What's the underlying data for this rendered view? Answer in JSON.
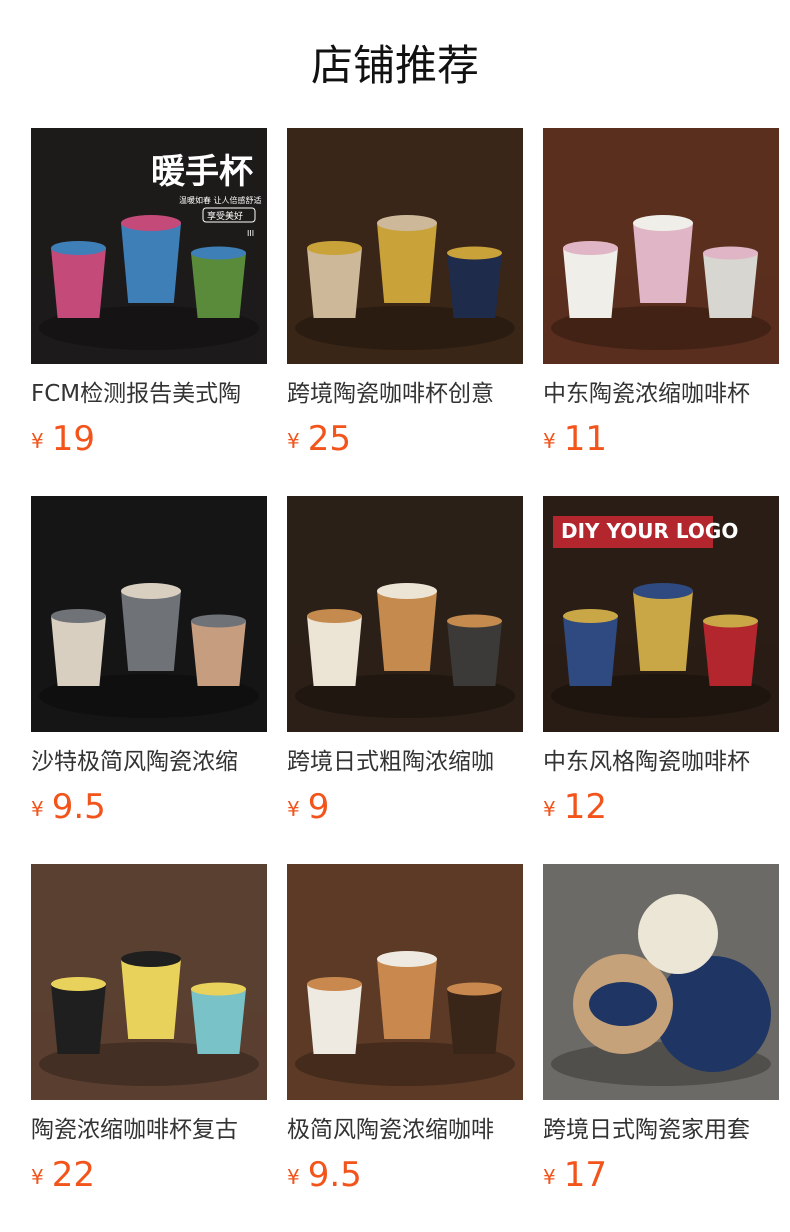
{
  "section": {
    "title": "店铺推荐"
  },
  "currency": "¥",
  "products": [
    {
      "name": "FCM检测报告美式陶",
      "price": "19",
      "image": "handwarmer-mug-banner",
      "overlay_title": "暖手杯",
      "overlay_sub": "温暖如春 让人倍感舒适",
      "overlay_tag": "享受美好",
      "overlay_page": "III",
      "colors": [
        "#1c1b1a",
        "#c44a7a",
        "#3f7fb8",
        "#5a8b3b"
      ]
    },
    {
      "name": "跨境陶瓷咖啡杯创意",
      "price": "25",
      "image": "gold-plate-coffee-cups",
      "colors": [
        "#3a2618",
        "#cdb99a",
        "#c9a23a",
        "#1f2b4a"
      ]
    },
    {
      "name": "中东陶瓷浓缩咖啡杯",
      "price": "11",
      "image": "pink-white-textured-cups",
      "colors": [
        "#5a2f1e",
        "#efeee9",
        "#e0b5c6",
        "#d8d6d0"
      ]
    },
    {
      "name": "沙特极简风陶瓷浓缩",
      "price": "9.5",
      "image": "hand-holding-engraved-cup",
      "colors": [
        "#151515",
        "#d9cfc0",
        "#6f7378",
        "#c79d80"
      ]
    },
    {
      "name": "跨境日式粗陶浓缩咖",
      "price": "9",
      "image": "latte-art-cups-slate",
      "colors": [
        "#2b2018",
        "#ece4d4",
        "#c48a4e",
        "#3c3a38"
      ]
    },
    {
      "name": "中东风格陶瓷咖啡杯",
      "price": "12",
      "image": "diy-logo-cups",
      "overlay_title": "DIY YOUR LOGO",
      "colors": [
        "#2a1d16",
        "#2f4a80",
        "#c9a646",
        "#b3262e"
      ]
    },
    {
      "name": "陶瓷浓缩咖啡杯复古",
      "price": "22",
      "image": "colorful-cups-set",
      "colors": [
        "#5a4030",
        "#1f1f1f",
        "#e9d25b",
        "#79c2c7"
      ]
    },
    {
      "name": "极简风陶瓷浓缩咖啡",
      "price": "9.5",
      "image": "white-cups-latte",
      "colors": [
        "#5c3a26",
        "#eeeae2",
        "#c9894e",
        "#3a2519"
      ]
    },
    {
      "name": "跨境日式陶瓷家用套",
      "price": "17",
      "image": "blue-tableware-set",
      "colors": [
        "#6c6a66",
        "#1f3563",
        "#ece6d7",
        "#c6a27a"
      ]
    }
  ]
}
